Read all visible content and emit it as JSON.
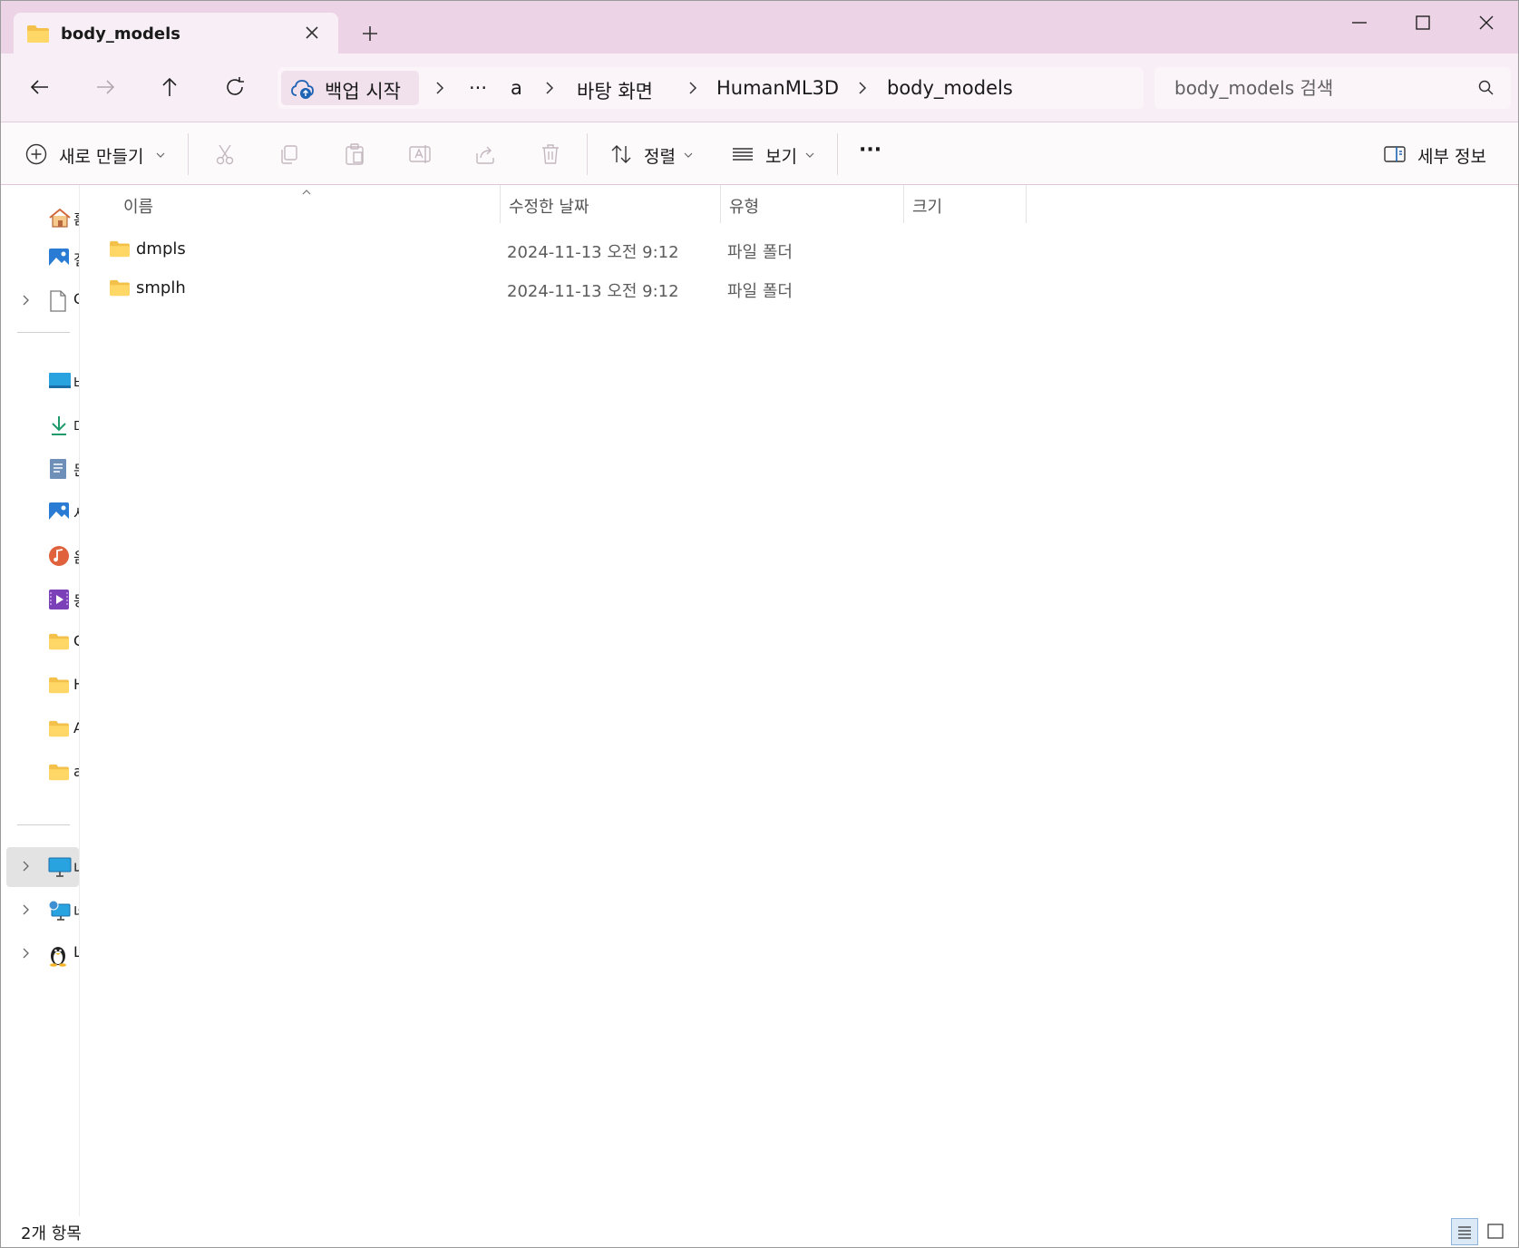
{
  "tab": {
    "title": "body_models"
  },
  "breadcrumb": {
    "backup_label": "백업 시작",
    "items": [
      "···",
      "a",
      "바탕 화면",
      "HumanML3D",
      "body_models"
    ]
  },
  "search": {
    "placeholder": "body_models 검색"
  },
  "commands": {
    "new": "새로 만들기",
    "sort": "정렬",
    "view": "보기",
    "more": "···",
    "details": "세부 정보"
  },
  "columns": {
    "name": "이름",
    "modified": "수정한 날짜",
    "type": "유형",
    "size": "크기"
  },
  "files": [
    {
      "name": "dmpls",
      "modified": "2024-11-13 오전 9:12",
      "type": "파일 폴더",
      "size": ""
    },
    {
      "name": "smplh",
      "modified": "2024-11-13 오전 9:12",
      "type": "파일 폴더",
      "size": ""
    }
  ],
  "nav_items": [
    {
      "icon": "home-icon",
      "label": "홈"
    },
    {
      "icon": "gallery-icon",
      "label": "갤"
    },
    {
      "icon": "document-icon",
      "label": "O"
    },
    {
      "icon": "desktop-icon",
      "label": "바"
    },
    {
      "icon": "download-icon",
      "label": "다"
    },
    {
      "icon": "documents-icon",
      "label": "문"
    },
    {
      "icon": "pictures-icon",
      "label": "사"
    },
    {
      "icon": "music-icon",
      "label": "음"
    },
    {
      "icon": "videos-icon",
      "label": "동"
    },
    {
      "icon": "folder-icon",
      "label": "C"
    },
    {
      "icon": "folder-icon",
      "label": "H"
    },
    {
      "icon": "folder-icon",
      "label": "A"
    },
    {
      "icon": "folder-icon",
      "label": "a"
    },
    {
      "icon": "this-pc-icon",
      "label": "내"
    },
    {
      "icon": "network-icon",
      "label": "네"
    },
    {
      "icon": "linux-icon",
      "label": "L"
    }
  ],
  "status": {
    "count": "2개 항목"
  },
  "colors": {
    "titlebar": "#ecd3e6",
    "folder": "#f3c04a",
    "accent": "#1e63b4"
  }
}
